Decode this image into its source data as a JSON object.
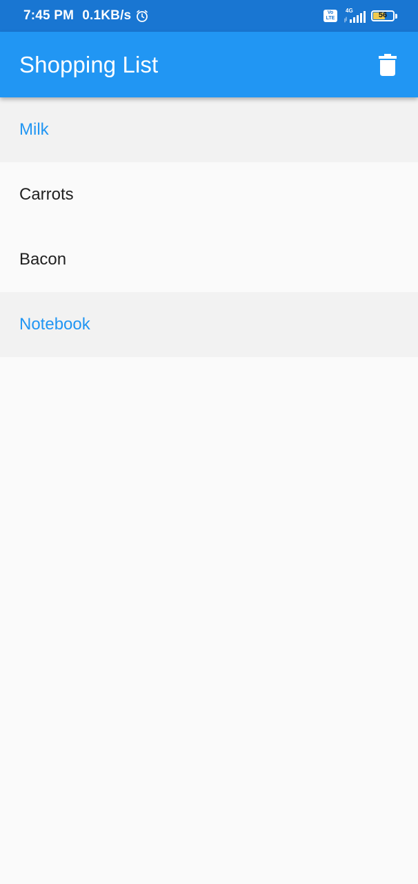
{
  "status_bar": {
    "time": "7:45 PM",
    "speed": "0.1KB/s",
    "volte_top": "Vo",
    "volte_bottom": "LTE",
    "network": "4G",
    "battery": "56",
    "battery_level": 0.56
  },
  "app_bar": {
    "title": "Shopping List",
    "delete_icon": "delete-icon"
  },
  "colors": {
    "status_bar": "#1976d2",
    "primary": "#2196f3",
    "background": "#fafafa",
    "selected_background": "#f2f2f2",
    "text": "#212121"
  },
  "items": [
    {
      "label": "Milk",
      "selected": true
    },
    {
      "label": "Carrots",
      "selected": false
    },
    {
      "label": "Bacon",
      "selected": false
    },
    {
      "label": "Notebook",
      "selected": true
    }
  ]
}
